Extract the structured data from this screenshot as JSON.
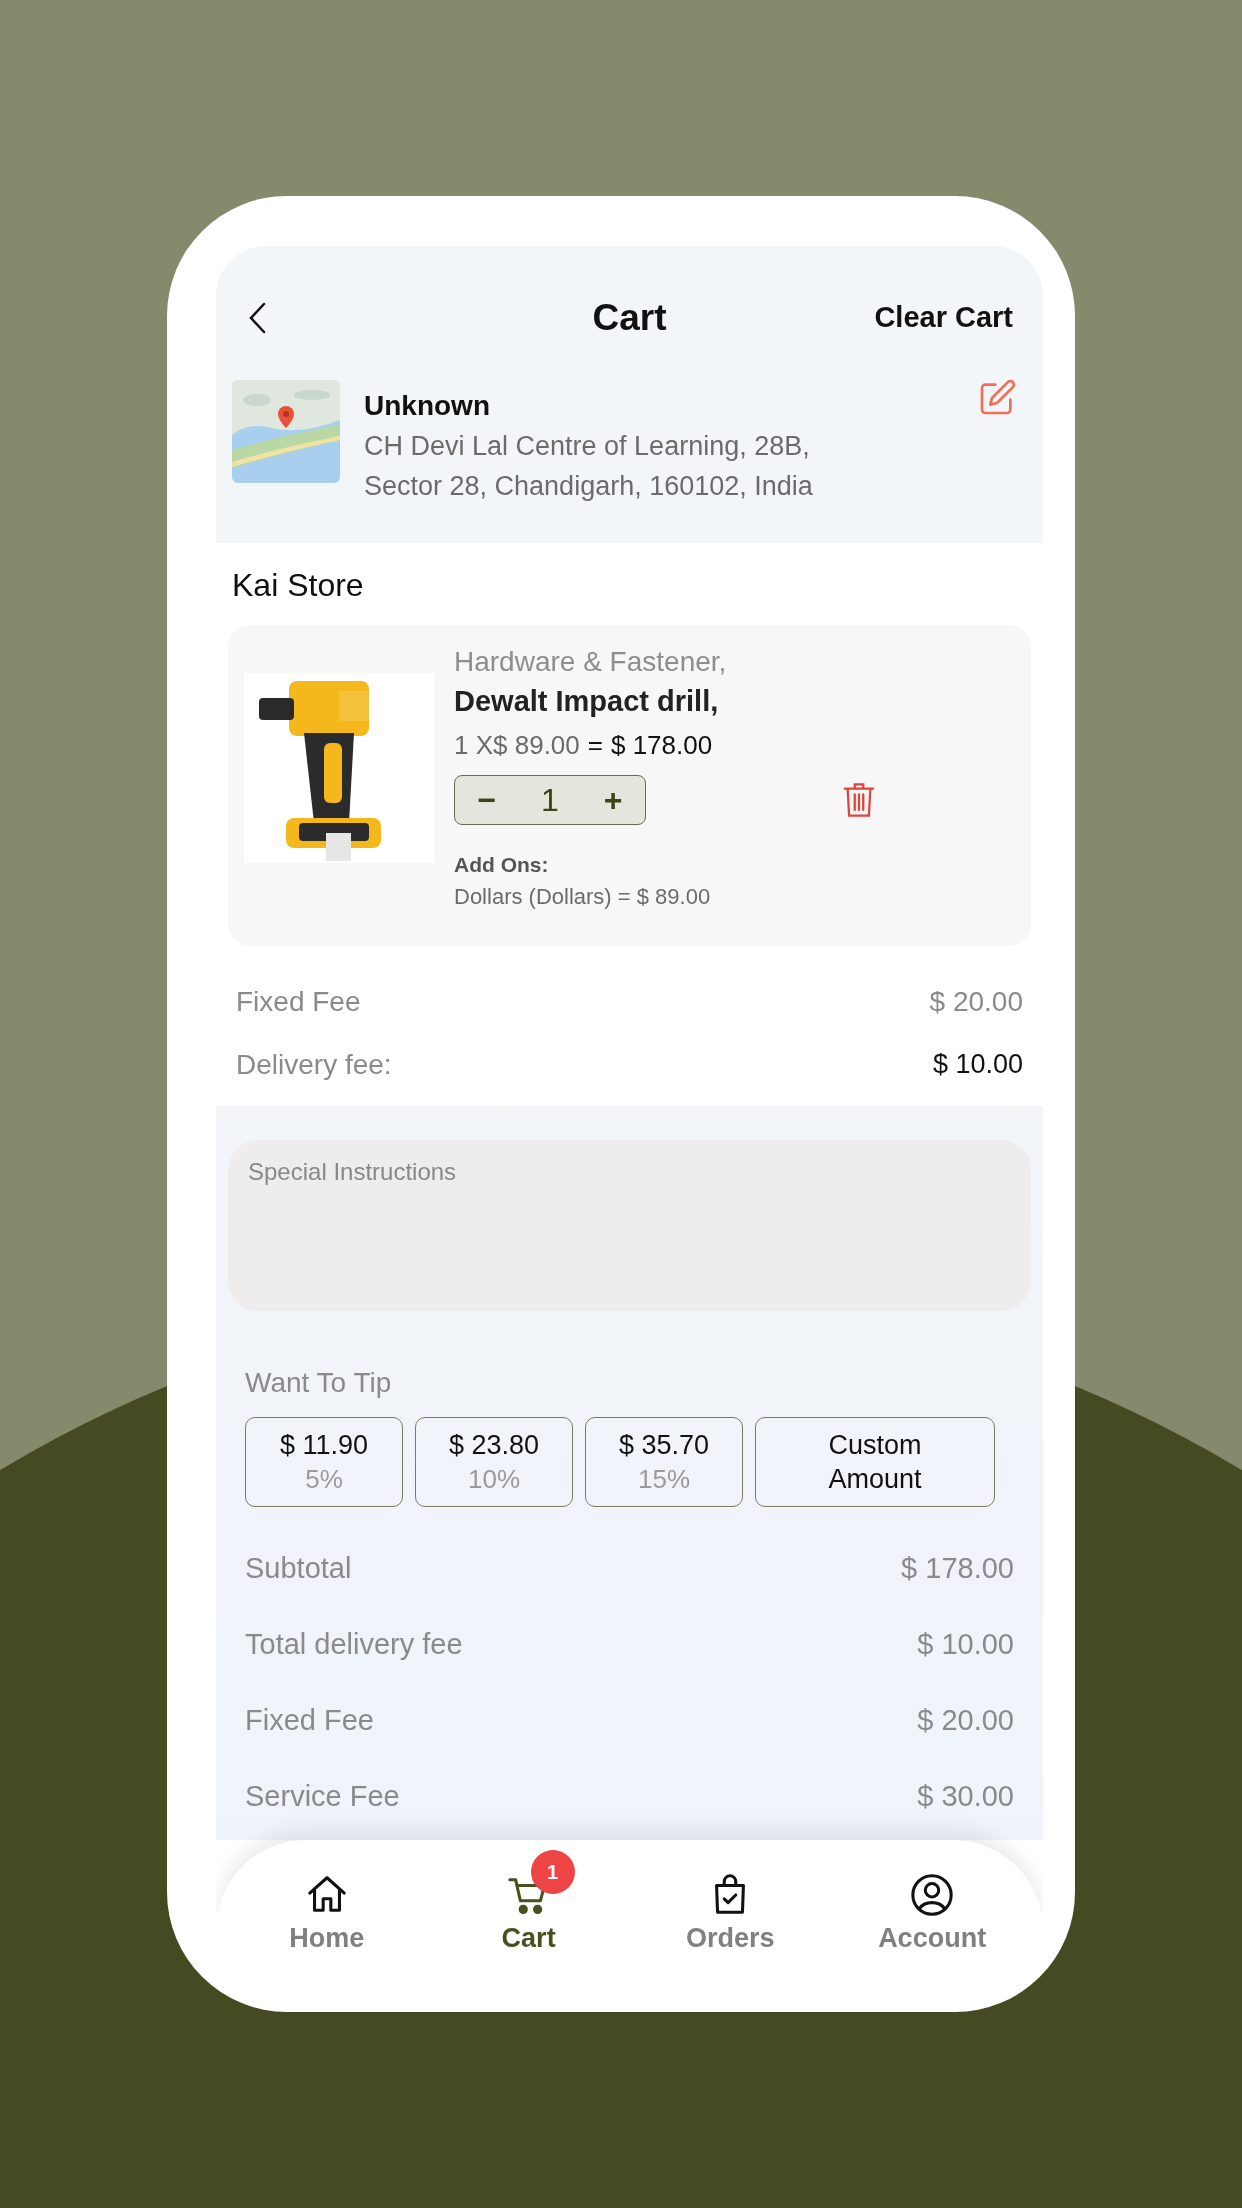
{
  "header": {
    "title": "Cart",
    "clear_action": "Clear Cart"
  },
  "address": {
    "name": "Unknown",
    "lines": [
      "CH Devi Lal Centre of Learning, 28B,",
      "Sector 28, Chandigarh, 160102, India"
    ]
  },
  "store_name": "Kai Store",
  "items": [
    {
      "category": "Hardware & Fastener,",
      "name": "Dewalt Impact drill,",
      "unit_line": "1 X$ 89.00",
      "equals": "=",
      "total": "$ 178.00",
      "minus": "−",
      "quantity": "1",
      "plus": "+",
      "addons_label": "Add Ons:",
      "addons": "Dollars (Dollars) = $ 89.00"
    }
  ],
  "fees": [
    {
      "label": "Fixed Fee",
      "value": "$ 20.00",
      "highlighted": false
    },
    {
      "label": "Delivery fee:",
      "value": "$ 10.00",
      "highlighted": true
    }
  ],
  "instructions": {
    "placeholder": "Special Instructions"
  },
  "tip": {
    "label": "Want To Tip",
    "options": [
      {
        "kind": "percent",
        "amount": "$ 11.90",
        "percent": "5%",
        "selected": false
      },
      {
        "kind": "percent",
        "amount": "$ 23.80",
        "percent": "10%",
        "selected": false
      },
      {
        "kind": "percent",
        "amount": "$ 35.70",
        "percent": "15%",
        "selected": false
      },
      {
        "kind": "custom",
        "lines": [
          "Custom",
          "Amount"
        ],
        "selected": false
      }
    ]
  },
  "summary": [
    {
      "label": "Subtotal",
      "value": "$ 178.00"
    },
    {
      "label": "Total delivery fee",
      "value": "$ 10.00"
    },
    {
      "label": "Fixed Fee",
      "value": "$ 20.00"
    },
    {
      "label": "Service Fee",
      "value": "$ 30.00"
    }
  ],
  "nav": [
    {
      "kind": "home",
      "label": "Home",
      "selected": false
    },
    {
      "kind": "cart",
      "label": "Cart",
      "selected": true,
      "badge": "1"
    },
    {
      "kind": "orders",
      "label": "Orders",
      "selected": false
    },
    {
      "kind": "account",
      "label": "Account",
      "selected": false
    }
  ]
}
